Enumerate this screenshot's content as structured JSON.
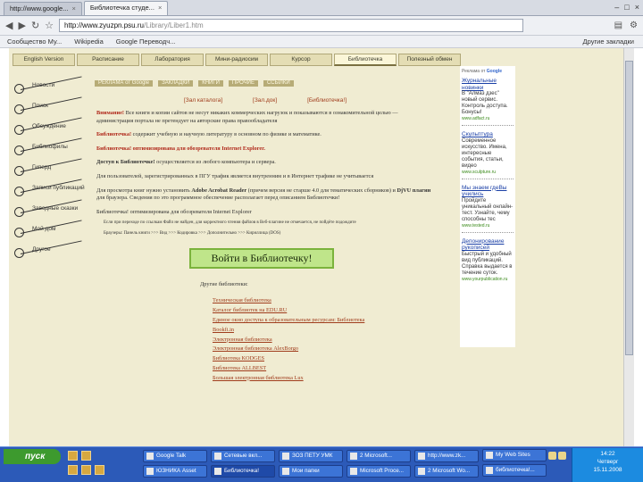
{
  "browser": {
    "tabs": [
      {
        "label": "http://www.google..."
      },
      {
        "label": "Библиотечка студе..."
      }
    ],
    "url_main": "http://www.zyuzpn.psu.ru",
    "url_path": "/Library/Liber1.htm",
    "bookmarks": [
      "Сообщество Му...",
      "Wikipedia",
      "Google Переводч..."
    ],
    "bookmarks_other": "Другие закладки"
  },
  "site": {
    "topnav": [
      "English Version",
      "Расписание",
      "Лаборатория",
      "Мини-радиосим",
      "Курсор",
      "Библиотечка",
      "Полезный обмен"
    ],
    "topnav_active_index": 5,
    "leftnav": [
      "Новости",
      "Поиск",
      "Обсуждение",
      "Библиофилы",
      "Гиперд",
      "Записи публикаций",
      "Заводные сказки",
      "Мой дом",
      "Другое"
    ],
    "subtabs": [
      "РЕКЛАМА от Google",
      "ЗАКЛАДКИ",
      "КНИГИ",
      "ПРОЧИЕ",
      "ССЫЛКИ"
    ],
    "links3": [
      "[Зал каталога]",
      "[Зал.док]",
      "[Библиотечка!]"
    ],
    "p_warn_label": "Внимание!",
    "p_warn": " Все книги и копии сайтов не несут никаких коммерческих нагрузок и показываются в ознакомительной целью — администрация портала не претендует на авторские права правообладателя",
    "p_bib1_label": "Библиотечка!",
    "p_bib1": " содержит учебную и научную литературу в основном по физике и математике.",
    "p_bib2_label": "Библиотечка! оптимизирована для обозревателя Internet Explorer.",
    "p_access_label": "Доступ к Библиотечке!",
    "p_access": " осуществляется из любого компьютера и сервера.",
    "p_traffic_label": "Для пользователей, зарегистрированных в ПГУ трафик является внутренним и в Интернет трафике не учитывается",
    "p_reader": "Для просмотра книг нужно установить ",
    "p_reader_b1": "Adobe Acrobat Reader",
    "p_reader_2": " (причем версия не старше 4.0 для тематических сборников) и ",
    "p_reader_b2": "DjVU плагин",
    "p_reader_3": " для браузера. Сведения по это программное обеспечение располагает перед описанием Библиотечки!",
    "p_opt_label": "Библиотечка! оптимизирована для обозревателя Internet Explorer",
    "small_note": "Если при переходе по ссылкам Файл не найден, для корректного чтения файлов в Веб-плагине не отмечается, не пойдёте подождите",
    "small_note2": "Браузеры: Панель книги >>> Вид >>> Кодировка >>> Дополнительно >>> Кириллица (DOS)",
    "enter_button": "Войти в Библиотечку!",
    "other_libs_title": "Другие библиотеки:",
    "other_libs": [
      "Техническая библиотека",
      "Каталог библиотек на EDU.RU",
      "Единое окно доступа к образовательным ресурсам: Библиотека",
      "Bookfi.in",
      "Электронная библиотека",
      "Электронная библиотека AlexBorgo",
      "Библиотека KODGES",
      "Библиотека ALLBEST",
      "Большая электронная библиотека Lux"
    ]
  },
  "ads": {
    "ads_by_prefix": "Реклама от",
    "ads_by_brand": "Google",
    "items": [
      {
        "title": "Журнальные новинки",
        "desc": "В \"Алмаз дзес\" новый сервис. Контроль доступа. Бонусы!",
        "url": "www.adfact.ru"
      },
      {
        "title": "Скульптура",
        "desc": "Современное искусство. Имена, интересные события, статьи, видео",
        "url": "www.sculpture.ru"
      },
      {
        "title": "Мы знаем гдеВы учились",
        "desc": "Пройдите уникальный онлайн-тест. Узнайте, чему способны тес",
        "url": "www.tested.ru"
      },
      {
        "title": "Депонирование рукописей",
        "desc": "Быстрый и удобный вид публикаций. Справка выдается в течение суток.",
        "url": "www.yourpublication.ru"
      }
    ]
  },
  "taskbar": {
    "start": "пуск",
    "row1": [
      "Google Talk",
      "Сетевые вкл...",
      "ЗОЗ ПЕТУ УМК",
      "2 Microsoft...",
      "http://www.zk...",
      "My Web Sites"
    ],
    "row2": [
      "ЮЗНИКА Asset",
      "Библиотечка!",
      "Мои папки",
      "Microsoft Proce...",
      "2 Microsoft Wo...",
      "библиотечка!..."
    ],
    "lang": "RU",
    "time": "14:22",
    "day": "Четверг",
    "date": "15.11.2008"
  }
}
